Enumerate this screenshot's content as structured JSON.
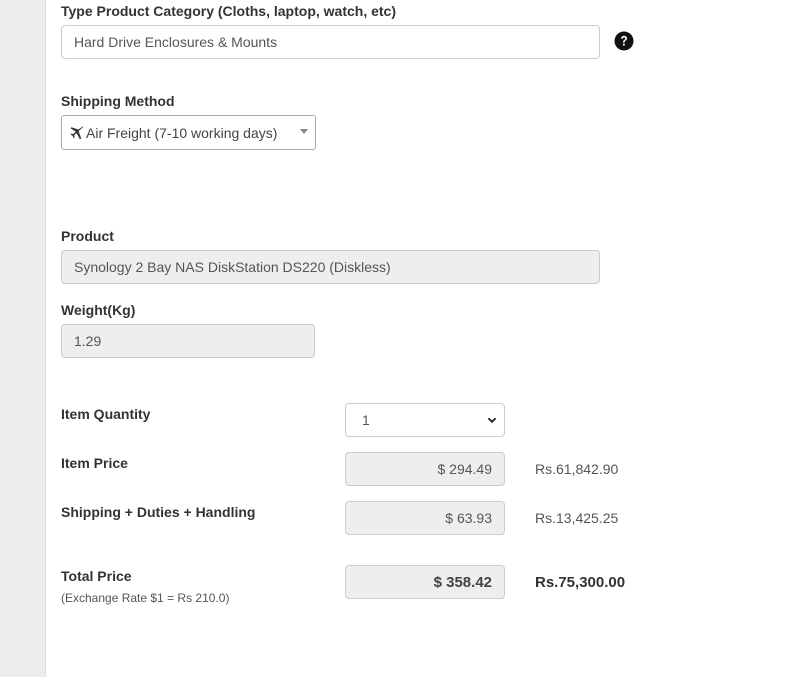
{
  "category": {
    "label": "Type Product Category (Cloths, laptop, watch, etc)",
    "value": "Hard Drive Enclosures & Mounts",
    "help_icon": "question-circle-icon"
  },
  "shipping": {
    "label": "Shipping Method",
    "selected": "Air Freight (7-10 working days)",
    "icon": "plane-icon"
  },
  "product": {
    "label": "Product",
    "value": "Synology 2 Bay NAS DiskStation DS220 (Diskless)"
  },
  "weight": {
    "label": "Weight(Kg)",
    "value": "1.29"
  },
  "quantity": {
    "label": "Item Quantity",
    "selected": "1"
  },
  "item_price": {
    "label": "Item Price",
    "usd": "$ 294.49",
    "lkr": "Rs.61,842.90"
  },
  "shipping_cost": {
    "label": "Shipping + Duties + Handling",
    "usd": "$ 63.93",
    "lkr": "Rs.13,425.25"
  },
  "total": {
    "label": "Total Price",
    "note": "(Exchange Rate $1 = Rs 210.0)",
    "usd": "$ 358.42",
    "lkr": "Rs.75,300.00"
  }
}
